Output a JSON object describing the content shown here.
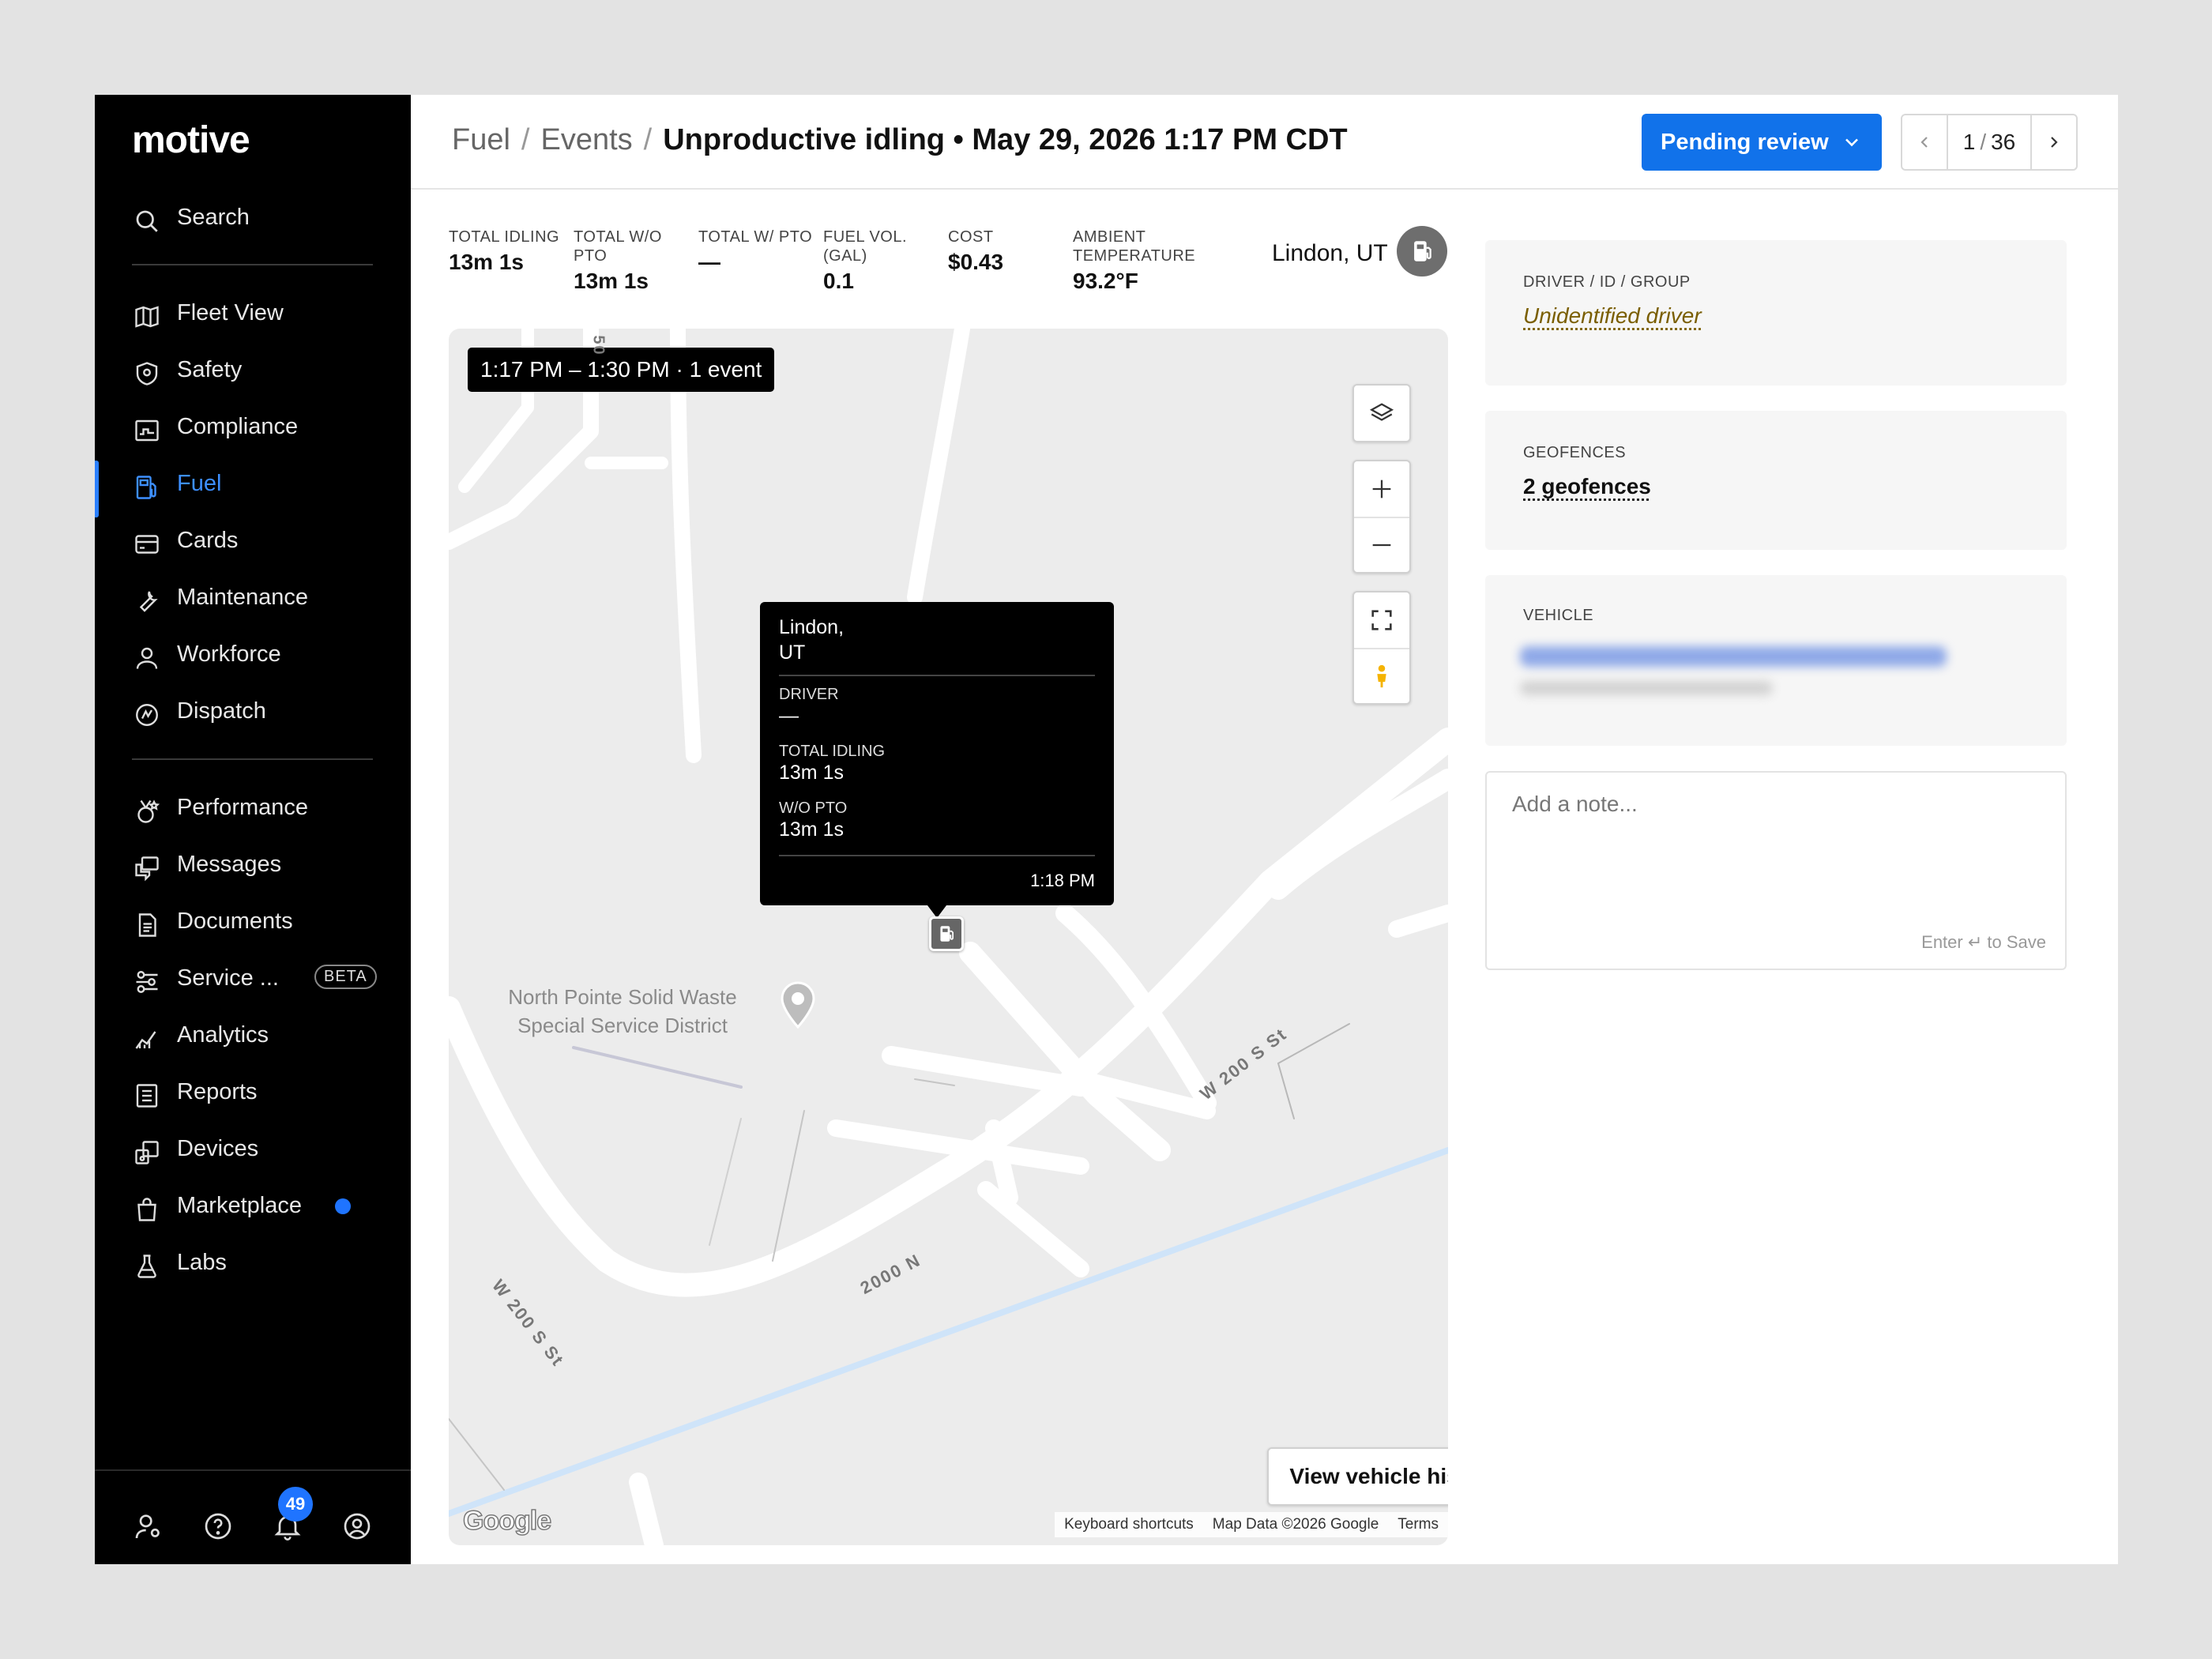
{
  "brand": {
    "logo": "motive"
  },
  "sidebar": {
    "search": "Search",
    "items": [
      {
        "label": "Fleet View"
      },
      {
        "label": "Safety"
      },
      {
        "label": "Compliance"
      },
      {
        "label": "Fuel"
      },
      {
        "label": "Cards"
      },
      {
        "label": "Maintenance"
      },
      {
        "label": "Workforce"
      },
      {
        "label": "Dispatch"
      },
      {
        "label": "Performance"
      },
      {
        "label": "Messages"
      },
      {
        "label": "Documents"
      },
      {
        "label": "Service ...",
        "badge": "BETA"
      },
      {
        "label": "Analytics"
      },
      {
        "label": "Reports"
      },
      {
        "label": "Devices"
      },
      {
        "label": "Marketplace"
      },
      {
        "label": "Labs"
      }
    ],
    "notifications_count": "49"
  },
  "header": {
    "crumb1": "Fuel",
    "crumb2": "Events",
    "current": "Unproductive idling • May 29, 2026 1:17 PM CDT",
    "sep": "/",
    "status_button": "Pending review",
    "pager_current": "1",
    "pager_sep": "/",
    "pager_total": "36"
  },
  "stats": {
    "total_idling": {
      "label": "TOTAL IDLING",
      "value": "13m 1s"
    },
    "total_wo_pto": {
      "label": "TOTAL W/O PTO",
      "value": "13m 1s"
    },
    "total_w_pto": {
      "label": "TOTAL W/ PTO",
      "value": "—"
    },
    "fuel_vol": {
      "label": "FUEL VOL. (GAL)",
      "value": "0.1"
    },
    "cost": {
      "label": "COST",
      "value": "$0.43"
    },
    "ambient": {
      "label": "AMBIENT TEMPERATURE",
      "value": "93.2°F"
    }
  },
  "location": "Lindon, UT",
  "map": {
    "time_range": "1:17 PM – 1:30 PM · 1 event",
    "popup": {
      "location_line1": "Lindon,",
      "location_line2": "UT",
      "driver_label": "DRIVER",
      "driver_value": "—",
      "idling_label": "TOTAL IDLING",
      "idling_value": "13m 1s",
      "wopto_label": "W/O PTO",
      "wopto_value": "13m 1s",
      "time": "1:18 PM"
    },
    "poi_line1": "North Pointe Solid Waste",
    "poi_line2": "Special Service District",
    "road_w200_upper": "W 200 S St",
    "road_2000n": "2000 N",
    "road_w200_lower": "W 200 S St",
    "road_top": "50",
    "view_history": "View vehicle history",
    "google": "Google",
    "attrib_shortcuts": "Keyboard shortcuts",
    "attrib_data": "Map Data ©2026 Google",
    "attrib_terms": "Terms"
  },
  "panel": {
    "driver_label": "DRIVER / ID / GROUP",
    "driver_value": "Unidentified driver",
    "geofences_label": "GEOFENCES",
    "geofences_value": "2 geofences",
    "vehicle_label": "VEHICLE",
    "note_placeholder": "Add a note...",
    "note_hint": "Enter ↵ to Save"
  },
  "colors": {
    "accent": "#1172ea",
    "sidebar_bg": "#000000",
    "driver_link": "#7a5e00"
  }
}
